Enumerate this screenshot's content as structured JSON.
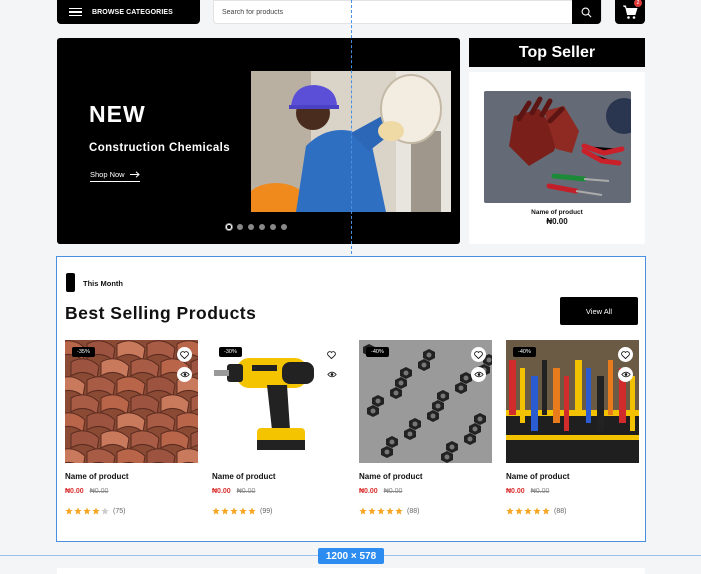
{
  "topbar": {
    "browse_label": "BROWSE CATEGORIES",
    "search_placeholder": "Search for products",
    "cart_count": "2"
  },
  "hero": {
    "title": "NEW",
    "subtitle": "Construction Chemicals",
    "cta": "Shop Now",
    "slide_count": 6,
    "active_slide": 1
  },
  "top_seller": {
    "heading": "Top Seller",
    "product_name": "Name of product",
    "price": "₦0.00"
  },
  "best_selling": {
    "tag": "This Month",
    "title": "Best Selling Products",
    "view_all": "View All",
    "products": [
      {
        "discount": "-35%",
        "name": "Name of product",
        "price": "₦0.00",
        "old_price": "₦0.00",
        "rating": 4,
        "reviews": "(75)",
        "image": "roof-tiles"
      },
      {
        "discount": "-30%",
        "name": "Name of product",
        "price": "₦0.00",
        "old_price": "₦0.00",
        "rating": 5,
        "reviews": "(99)",
        "image": "cordless-drill"
      },
      {
        "discount": "-40%",
        "name": "Name of product",
        "price": "₦0.00",
        "old_price": "₦0.00",
        "rating": 5,
        "reviews": "(88)",
        "image": "hex-nuts"
      },
      {
        "discount": "-40%",
        "name": "Name of product",
        "price": "₦0.00",
        "old_price": "₦0.00",
        "rating": 5,
        "reviews": "(88)",
        "image": "tool-bag"
      }
    ]
  },
  "frame_label": "1200 × 578",
  "colors": {
    "accent": "#000000",
    "sale_price": "#d9302f",
    "star": "#f5a623",
    "star_empty": "#cccccc",
    "guide": "#4a90e2"
  }
}
